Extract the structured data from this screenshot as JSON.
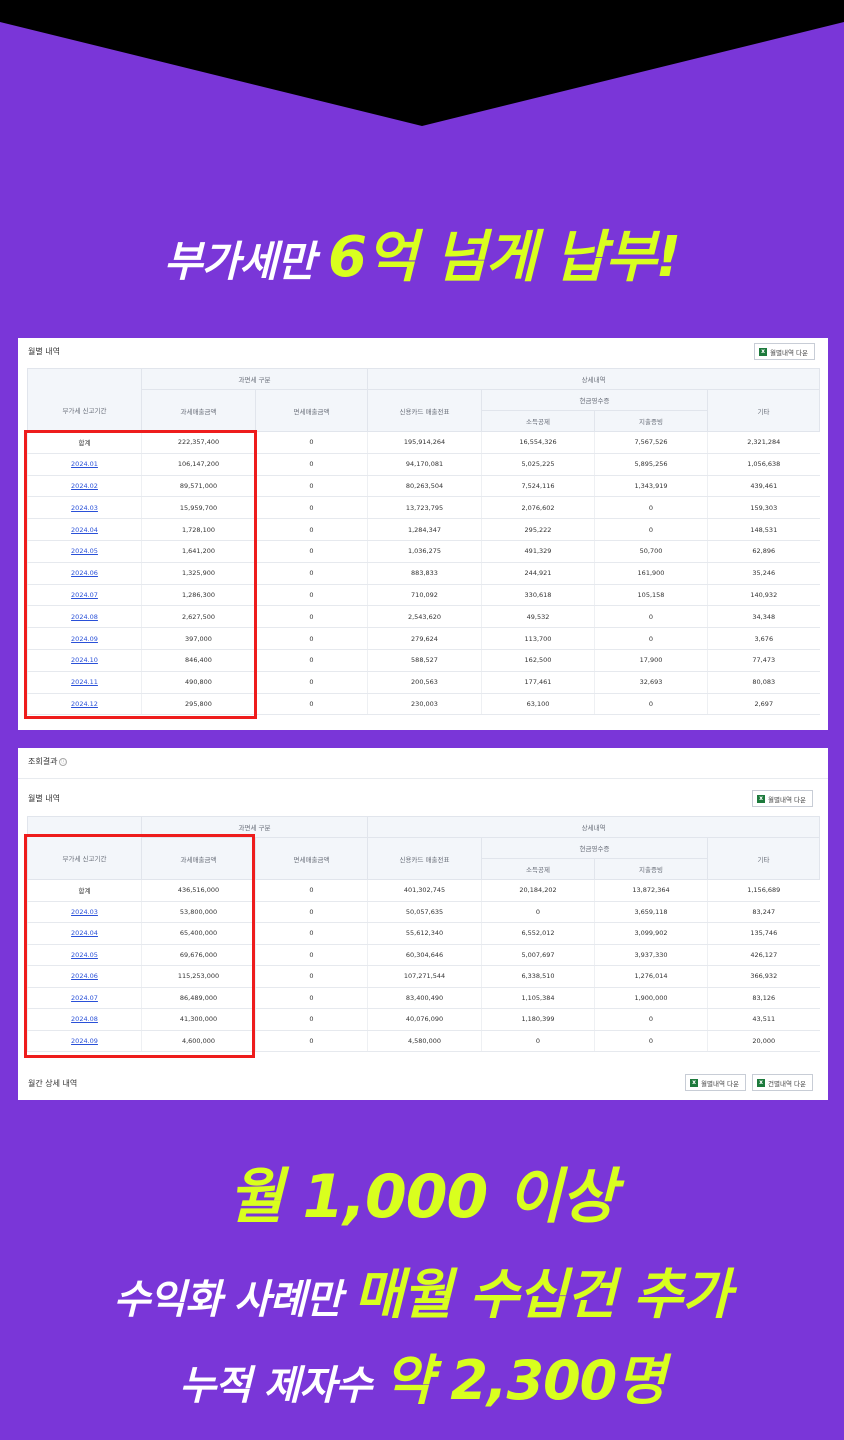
{
  "colors": {
    "background": "#7a36d8",
    "accent": "#d9ff1e",
    "highlight_box": "#ee1c1c"
  },
  "headline": {
    "white": "부가세만 ",
    "yellow": "6억 넘게 납부!"
  },
  "panel1": {
    "title": "월별 내역",
    "download_button": "월별내역 다운",
    "headers": {
      "period": "부가세 신고기간",
      "group1": "과면세 구분",
      "group2": "상세내역",
      "taxable": "과세매출금액",
      "exempt": "면세매출금액",
      "card": "신용카드 매출전표",
      "cash": "현금영수증",
      "deduct": "소득공제",
      "proof": "지출증빙",
      "other": "기타"
    },
    "rows": [
      [
        "합계",
        "222,357,400",
        "0",
        "195,914,264",
        "16,554,326",
        "7,567,526",
        "2,321,284"
      ],
      [
        "2024.01",
        "106,147,200",
        "0",
        "94,170,081",
        "5,025,225",
        "5,895,256",
        "1,056,638"
      ],
      [
        "2024.02",
        "89,571,000",
        "0",
        "80,263,504",
        "7,524,116",
        "1,343,919",
        "439,461"
      ],
      [
        "2024.03",
        "15,959,700",
        "0",
        "13,723,795",
        "2,076,602",
        "0",
        "159,303"
      ],
      [
        "2024.04",
        "1,728,100",
        "0",
        "1,284,347",
        "295,222",
        "0",
        "148,531"
      ],
      [
        "2024.05",
        "1,641,200",
        "0",
        "1,036,275",
        "491,329",
        "50,700",
        "62,896"
      ],
      [
        "2024.06",
        "1,325,900",
        "0",
        "883,833",
        "244,921",
        "161,900",
        "35,246"
      ],
      [
        "2024.07",
        "1,286,300",
        "0",
        "710,092",
        "330,618",
        "105,158",
        "140,932"
      ],
      [
        "2024.08",
        "2,627,500",
        "0",
        "2,543,620",
        "49,532",
        "0",
        "34,348"
      ],
      [
        "2024.09",
        "397,000",
        "0",
        "279,624",
        "113,700",
        "0",
        "3,676"
      ],
      [
        "2024.10",
        "846,400",
        "0",
        "588,527",
        "162,500",
        "17,900",
        "77,473"
      ],
      [
        "2024.11",
        "490,800",
        "0",
        "200,563",
        "177,461",
        "32,693",
        "80,083"
      ],
      [
        "2024.12",
        "295,800",
        "0",
        "230,003",
        "63,100",
        "0",
        "2,697"
      ]
    ]
  },
  "panel2": {
    "section_title": "조회결과",
    "info_icon": "ⓘ",
    "title": "월별 내역",
    "download_button": "월별내역 다운",
    "headers": {
      "period": "부가세 신고기간",
      "group1": "과면세 구분",
      "group2": "상세내역",
      "taxable": "과세매출금액",
      "exempt": "면세매출금액",
      "card": "신용카드 매출전표",
      "cash": "현금영수증",
      "deduct": "소득공제",
      "proof": "지출증빙",
      "other": "기타"
    },
    "rows": [
      [
        "합계",
        "436,516,000",
        "0",
        "401,302,745",
        "20,184,202",
        "13,872,364",
        "1,156,689"
      ],
      [
        "2024.03",
        "53,800,000",
        "0",
        "50,057,635",
        "0",
        "3,659,118",
        "83,247"
      ],
      [
        "2024.04",
        "65,400,000",
        "0",
        "55,612,340",
        "6,552,012",
        "3,099,902",
        "135,746"
      ],
      [
        "2024.05",
        "69,676,000",
        "0",
        "60,304,646",
        "5,007,697",
        "3,937,330",
        "426,127"
      ],
      [
        "2024.06",
        "115,253,000",
        "0",
        "107,271,544",
        "6,338,510",
        "1,276,014",
        "366,932"
      ],
      [
        "2024.07",
        "86,489,000",
        "0",
        "83,400,490",
        "1,105,384",
        "1,900,000",
        "83,126"
      ],
      [
        "2024.08",
        "41,300,000",
        "0",
        "40,076,090",
        "1,180,399",
        "0",
        "43,511"
      ],
      [
        "2024.09",
        "4,600,000",
        "0",
        "4,580,000",
        "0",
        "0",
        "20,000"
      ]
    ],
    "footer_title": "월간 상세 내역",
    "footer_button1": "월별내역 다운",
    "footer_button2": "건별내역 다운"
  },
  "bottom": {
    "line1": "월 1,000 이상",
    "line2_white": "수익화 사례만 ",
    "line2_yellow": "매월 수십건 추가",
    "line3_white": "누적 제자수 ",
    "line3_yellow": "약 2,300명"
  }
}
